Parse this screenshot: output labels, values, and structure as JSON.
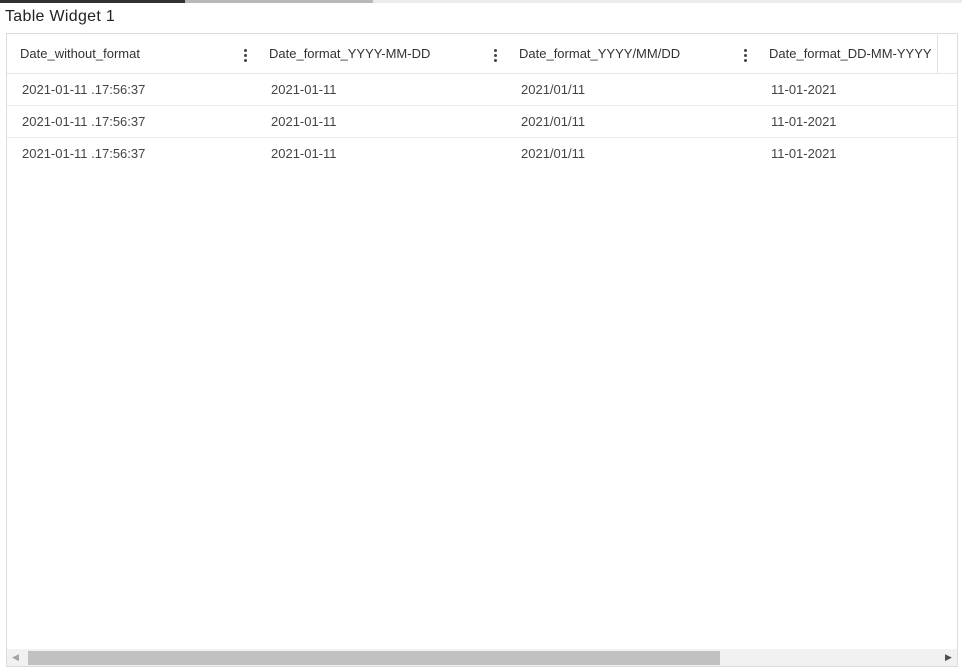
{
  "widget": {
    "title": "Table Widget 1"
  },
  "table": {
    "columns": [
      {
        "label": "Date_without_format"
      },
      {
        "label": "Date_format_YYYY-MM-DD"
      },
      {
        "label": "Date_format_YYYY/MM/DD"
      },
      {
        "label": "Date_format_DD-MM-YYYY"
      }
    ],
    "rows": [
      [
        "2021-01-11 .17:56:37",
        "2021-01-11",
        "2021/01/11",
        "11-01-2021"
      ],
      [
        "2021-01-11 .17:56:37",
        "2021-01-11",
        "2021/01/11",
        "11-01-2021"
      ],
      [
        "2021-01-11 .17:56:37",
        "2021-01-11",
        "2021/01/11",
        "11-01-2021"
      ]
    ]
  },
  "scrollbar": {
    "left_arrow_icon": "triangle-left-icon",
    "right_arrow_icon": "triangle-right-icon"
  }
}
